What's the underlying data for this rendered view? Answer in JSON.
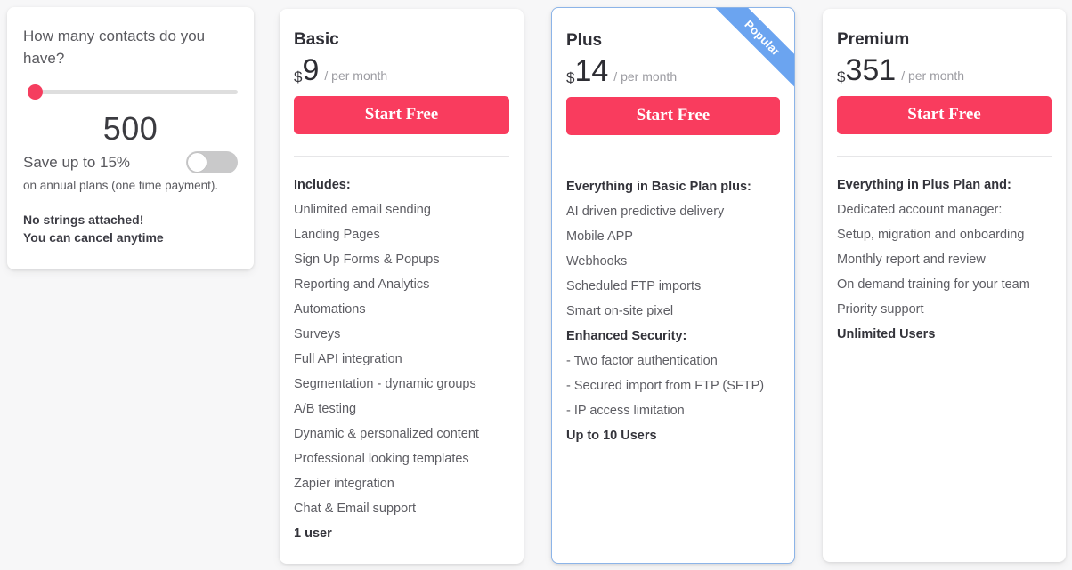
{
  "calculator": {
    "question": "How many contacts do you have?",
    "slider": {
      "value": 500,
      "min_position_percent": 0
    },
    "value_display": "500",
    "save_label": "Save up to 15%",
    "toggle_state": "off",
    "sub_text": "on annual plans (one time payment).",
    "note_line1": "No strings attached!",
    "note_line2": "You can cancel anytime"
  },
  "colors": {
    "cta": "#f93c5e",
    "slider_thumb": "#f53e5f",
    "ribbon": "#6ba4f0",
    "plus_border": "#8cb4e8",
    "page_background": "#f7f7f8"
  },
  "plans": [
    {
      "id": "basic",
      "title": "Basic",
      "currency": "$",
      "amount": "9",
      "period": "/ per month",
      "cta_label": "Start Free",
      "features": [
        {
          "text": "Includes:",
          "strong": true
        },
        {
          "text": "Unlimited email sending",
          "strong": false
        },
        {
          "text": "Landing Pages",
          "strong": false
        },
        {
          "text": "Sign Up Forms & Popups",
          "strong": false
        },
        {
          "text": "Reporting and Analytics",
          "strong": false
        },
        {
          "text": "Automations",
          "strong": false
        },
        {
          "text": "Surveys",
          "strong": false
        },
        {
          "text": "Full API integration",
          "strong": false
        },
        {
          "text": "Segmentation - dynamic groups",
          "strong": false
        },
        {
          "text": "A/B testing",
          "strong": false
        },
        {
          "text": "Dynamic & personalized content",
          "strong": false
        },
        {
          "text": "Professional looking templates",
          "strong": false
        },
        {
          "text": "Zapier integration",
          "strong": false
        },
        {
          "text": "Chat & Email support",
          "strong": false
        },
        {
          "text": "1 user",
          "strong": true
        }
      ]
    },
    {
      "id": "plus",
      "title": "Plus",
      "currency": "$",
      "amount": "14",
      "period": "/ per month",
      "cta_label": "Start Free",
      "ribbon_label": "Popular",
      "features": [
        {
          "text": "Everything in Basic Plan plus:",
          "strong": true
        },
        {
          "text": "AI driven predictive delivery",
          "strong": false
        },
        {
          "text": "Mobile APP",
          "strong": false
        },
        {
          "text": "Webhooks",
          "strong": false
        },
        {
          "text": "Scheduled FTP imports",
          "strong": false
        },
        {
          "text": "Smart on-site pixel",
          "strong": false
        },
        {
          "text": "Enhanced Security:",
          "strong": true
        },
        {
          "text": "- Two factor authentication",
          "strong": false
        },
        {
          "text": "- Secured import from FTP (SFTP)",
          "strong": false
        },
        {
          "text": "- IP access limitation",
          "strong": false
        },
        {
          "text": "Up to 10 Users",
          "strong": true
        }
      ]
    },
    {
      "id": "premium",
      "title": "Premium",
      "currency": "$",
      "amount": "351",
      "period": "/ per month",
      "cta_label": "Start Free",
      "features": [
        {
          "text": "Everything in Plus Plan and:",
          "strong": true
        },
        {
          "text": "Dedicated account manager:",
          "strong": false
        },
        {
          "text": "Setup, migration and onboarding",
          "strong": false
        },
        {
          "text": "Monthly report and review",
          "strong": false
        },
        {
          "text": "On demand training for your team",
          "strong": false
        },
        {
          "text": "Priority support",
          "strong": false
        },
        {
          "text": "Unlimited Users",
          "strong": true
        }
      ]
    }
  ]
}
